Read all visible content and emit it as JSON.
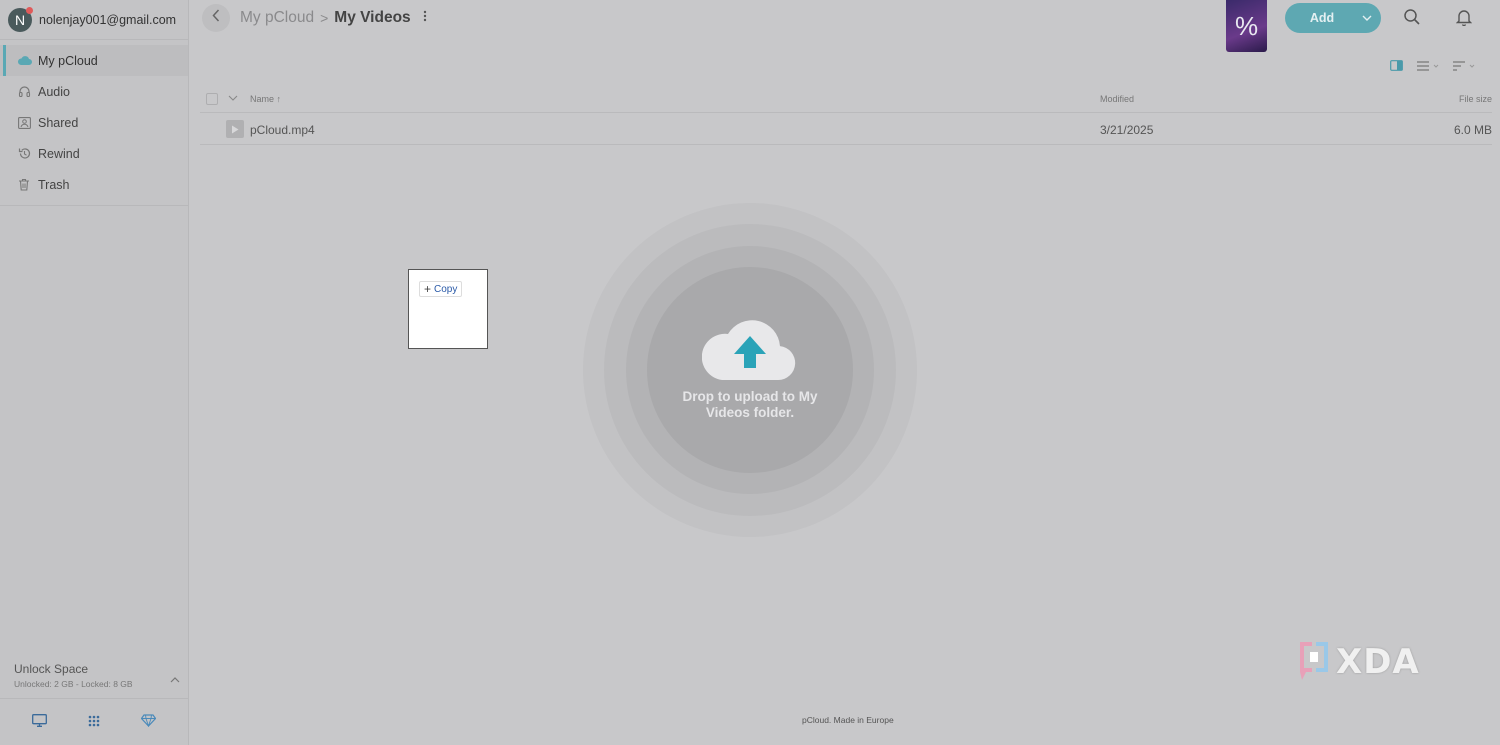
{
  "account": {
    "initial": "N",
    "email": "nolenjay001@gmail.com"
  },
  "sidebar": {
    "items": [
      {
        "label": "My pCloud",
        "icon": "cloud-icon",
        "active": true
      },
      {
        "label": "Audio",
        "icon": "headphones-icon",
        "active": false
      },
      {
        "label": "Shared",
        "icon": "shared-icon",
        "active": false
      },
      {
        "label": "Rewind",
        "icon": "rewind-icon",
        "active": false
      },
      {
        "label": "Trash",
        "icon": "trash-icon",
        "active": false
      }
    ],
    "unlock": {
      "title": "Unlock Space",
      "subtitle": "Unlocked: 2 GB - Locked: 8 GB"
    }
  },
  "breadcrumb": {
    "root": "My pCloud",
    "separator": ">",
    "current": "My Videos"
  },
  "header": {
    "promo_glyph": "%",
    "add_label": "Add"
  },
  "table": {
    "columns": {
      "name": "Name",
      "modified": "Modified",
      "size": "File size"
    },
    "rows": [
      {
        "name": "pCloud.mp4",
        "modified": "3/21/2025",
        "size": "6.0 MB"
      }
    ]
  },
  "dropzone": {
    "text": "Drop to upload to My Videos folder."
  },
  "drag": {
    "copy_label": "Copy"
  },
  "footer": {
    "text": "pCloud. Made in Europe"
  },
  "watermark": {
    "text": "XDA"
  },
  "colors": {
    "accent": "#5ea8b2",
    "upload_arrow": "#2aa3b8",
    "overlay": "#c8c8ca"
  }
}
